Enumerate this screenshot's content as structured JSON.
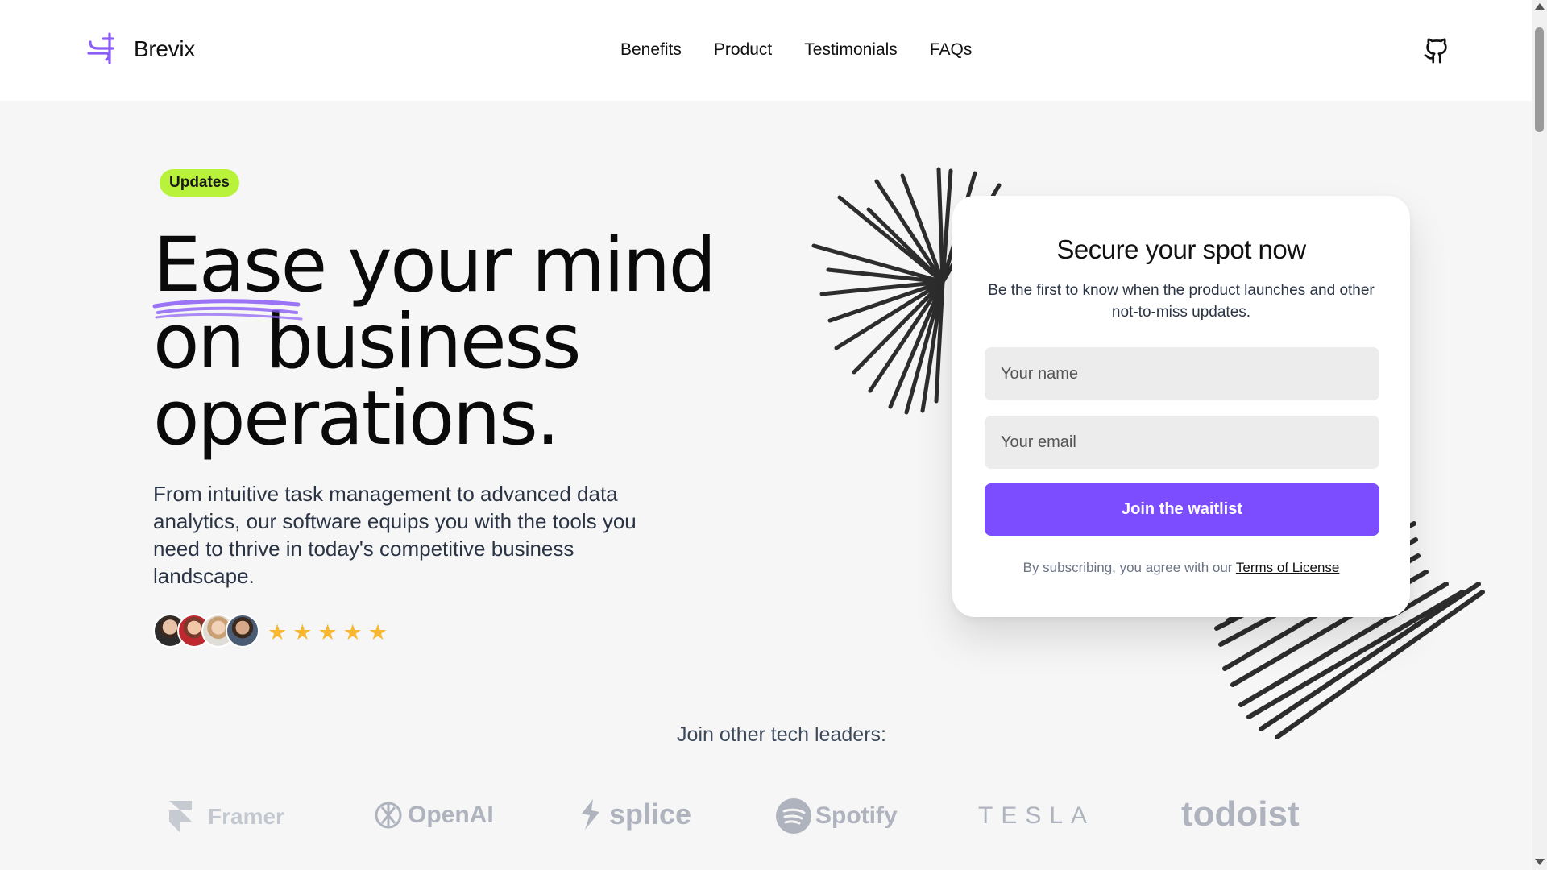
{
  "header": {
    "brand": "Brevix",
    "nav": [
      "Benefits",
      "Product",
      "Testimonials",
      "FAQs"
    ]
  },
  "hero": {
    "badge": "Updates",
    "headline": [
      "Ease your mind",
      "on business",
      "operations."
    ],
    "description": "From intuitive task management to advanced data analytics, our software equips you with the tools you need to thrive in today's competitive business landscape.",
    "rating_stars": 5
  },
  "form": {
    "title": "Secure your spot now",
    "subtitle": "Be the first to know when the product launches and other not-to-miss updates.",
    "name_placeholder": "Your name",
    "email_placeholder": "Your email",
    "button": "Join the waitlist",
    "terms_prefix": "By subscribing, you agree with our ",
    "terms_link": "Terms of License"
  },
  "leaders": {
    "title": "Join other tech leaders:",
    "logos": [
      "Framer",
      "OpenAI",
      "splice",
      "Spotify",
      "TESLA",
      "todoist"
    ]
  },
  "colors": {
    "accent": "#7c4dff",
    "badge": "#b8f23a",
    "stars": "#f7b731",
    "logo_gray": "#aeb3bd"
  }
}
